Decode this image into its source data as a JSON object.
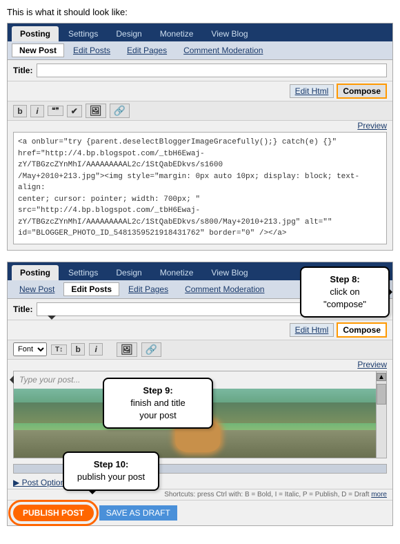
{
  "intro": {
    "text": "This is what it should look like:"
  },
  "top_section": {
    "tabs": {
      "top": [
        "Posting",
        "Settings",
        "Design",
        "Monetize",
        "View Blog"
      ],
      "sub": [
        "New Post",
        "Edit Posts",
        "Edit Pages",
        "Comment Moderation"
      ]
    },
    "title_label": "Title:",
    "btn_edit_html": "Edit Html",
    "btn_compose": "Compose",
    "preview": "Preview",
    "html_content": "<a onblur=\"try {parent.deselectBloggerImageGracefully();} catch(e) {}\"\nhref=\"http://4.bp.blogspot.com/_tbH6Ewaj-zY/TBGzcZYnMhI/AAAAAAAAAL2c/1StQabEDkvs/s1600\n/May+2010+213.jpg\"><img style=\"margin: 0px auto 10px; display: block; text-align:\ncenter; cursor: pointer; width: 700px; \" src=\"http://4.bp.blogspot.com/_tbH6Ewaj-\nzY/TBGzcZYnMhI/AAAAAAAAAL2c/1StQabEDkvs/s800/May+2010+213.jpg\" alt=\"\"\nid=\"BLOGGER_PHOTO_ID_5481359521918431762\" border=\"0\" /></a>"
  },
  "bottom_section": {
    "tabs": {
      "top": [
        "Posting",
        "Settings",
        "Design",
        "Monetize",
        "View Blog"
      ],
      "sub": [
        "New Post",
        "Edit Posts",
        "Edit Pages",
        "Comment Moderation"
      ]
    },
    "title_label": "Title:",
    "btn_edit_html": "Edit Html",
    "btn_compose": "Compose",
    "preview": "Preview",
    "font_label": "Font",
    "compose_placeholder": "Type your post...",
    "post_options": "▶ Post Options",
    "shortcuts": "Shortcuts: press Ctrl with: B = Bold, I = Italic, P = Publish, D = Draft",
    "more": "more",
    "btn_publish": "PUBLISH POST",
    "btn_save_draft": "SAVE AS DRAFT"
  },
  "callouts": {
    "step8": {
      "title": "Step 8:",
      "body": "click on \"compose\""
    },
    "step9": {
      "title": "Step 9:",
      "body": "finish and title\nyour post"
    },
    "step10": {
      "title": "Step 10:",
      "body": "publish your post"
    }
  },
  "icons": {
    "bold": "B",
    "italic": "I",
    "quote": "❝❞",
    "check": "✔",
    "image": "🖼",
    "link": "🔗",
    "font_size": "T↕",
    "bold2": "b",
    "italic2": "i"
  }
}
